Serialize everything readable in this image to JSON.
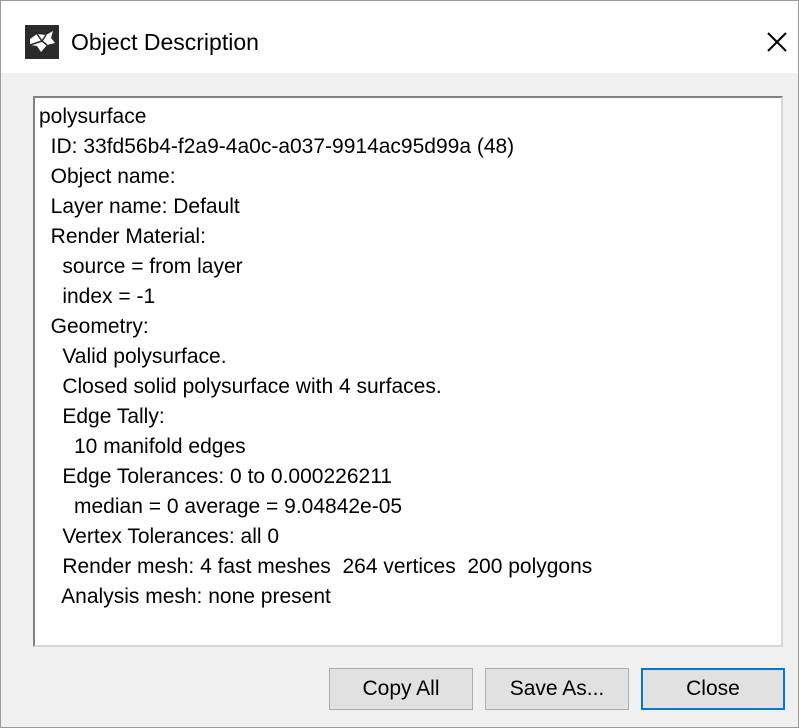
{
  "window": {
    "title": "Object Description",
    "app_icon": "rhino-icon",
    "close_icon": "close-icon"
  },
  "description": {
    "lines": [
      "polysurface",
      "  ID: 33fd56b4-f2a9-4a0c-a037-9914ac95d99a (48)",
      "  Object name:",
      "  Layer name: Default",
      "  Render Material:",
      "    source = from layer",
      "    index = -1",
      "  Geometry:",
      "    Valid polysurface.",
      "    Closed solid polysurface with 4 surfaces.",
      "    Edge Tally:",
      "      10 manifold edges",
      "    Edge Tolerances: 0 to 0.000226211",
      "      median = 0 average = 9.04842e-05",
      "    Vertex Tolerances: all 0",
      "    Render mesh: 4 fast meshes  264 vertices  200 polygons",
      "    Analysis mesh: none present"
    ]
  },
  "buttons": {
    "copy_all": "Copy All",
    "save_as": "Save As...",
    "close": "Close"
  },
  "colors": {
    "default_button_border": "#0078d7",
    "button_face": "#e1e1e1",
    "dialog_background": "#f0f0f0"
  }
}
